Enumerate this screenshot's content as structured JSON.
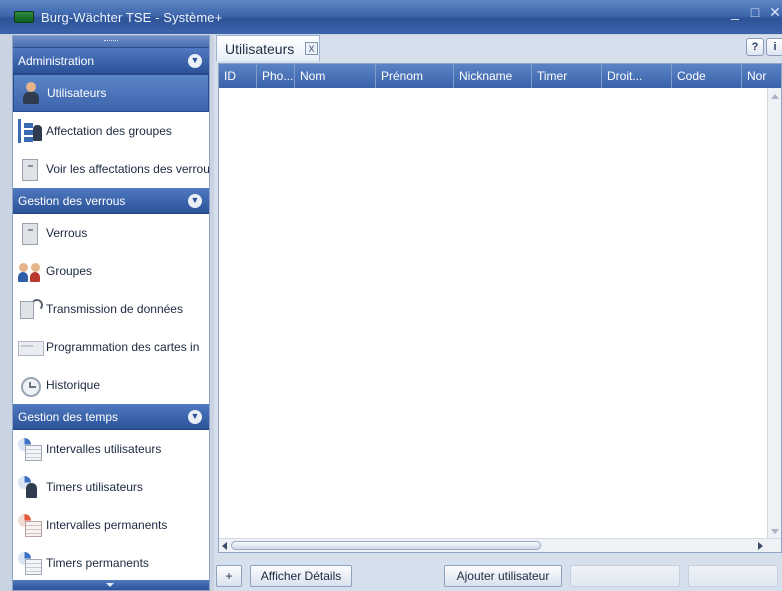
{
  "window": {
    "title": "Burg-Wächter TSE - Système+",
    "controls": {
      "minimize": "_",
      "maximize": "□",
      "close": "✕"
    }
  },
  "sidebar": {
    "sections": [
      {
        "title": "Administration",
        "items": [
          {
            "label": "Utilisateurs",
            "icon": "user-icon",
            "active": true
          },
          {
            "label": "Affectation des groupes",
            "icon": "group-tree-icon"
          },
          {
            "label": "Voir les affectations des verrous",
            "icon": "lock-user-icon"
          }
        ]
      },
      {
        "title": "Gestion des verrous",
        "items": [
          {
            "label": "Verrous",
            "icon": "door-icon"
          },
          {
            "label": "Groupes",
            "icon": "users-icon"
          },
          {
            "label": "Transmission de données",
            "icon": "radio-transmitter-icon"
          },
          {
            "label": "Programmation des cartes in",
            "icon": "card-icon"
          },
          {
            "label": "Historique",
            "icon": "history-icon"
          }
        ]
      },
      {
        "title": "Gestion des temps",
        "items": [
          {
            "label": "Intervalles utilisateurs",
            "icon": "interval-icon"
          },
          {
            "label": "Timers utilisateurs",
            "icon": "timer-user-icon"
          },
          {
            "label": "Intervalles permanents",
            "icon": "permanent-interval-icon"
          },
          {
            "label": "Timers permanents",
            "icon": "permanent-timer-icon"
          }
        ]
      }
    ]
  },
  "main": {
    "tab": {
      "label": "Utilisateurs",
      "close": "X"
    },
    "help_label": "?",
    "info_label": "i",
    "grid": {
      "columns": [
        "ID",
        "Pho...",
        "Nom",
        "Prénom",
        "Nickname",
        "Timer",
        "Droit...",
        "Code",
        "Nor"
      ],
      "rows": []
    },
    "buttons": {
      "add": "+",
      "details": "Afficher Détails",
      "add_user": "Ajouter utilisateur"
    }
  },
  "colors": {
    "header_blue": "#3a62a9",
    "active_item": "#4a72b8",
    "panel_bg": "#d6dfec"
  }
}
